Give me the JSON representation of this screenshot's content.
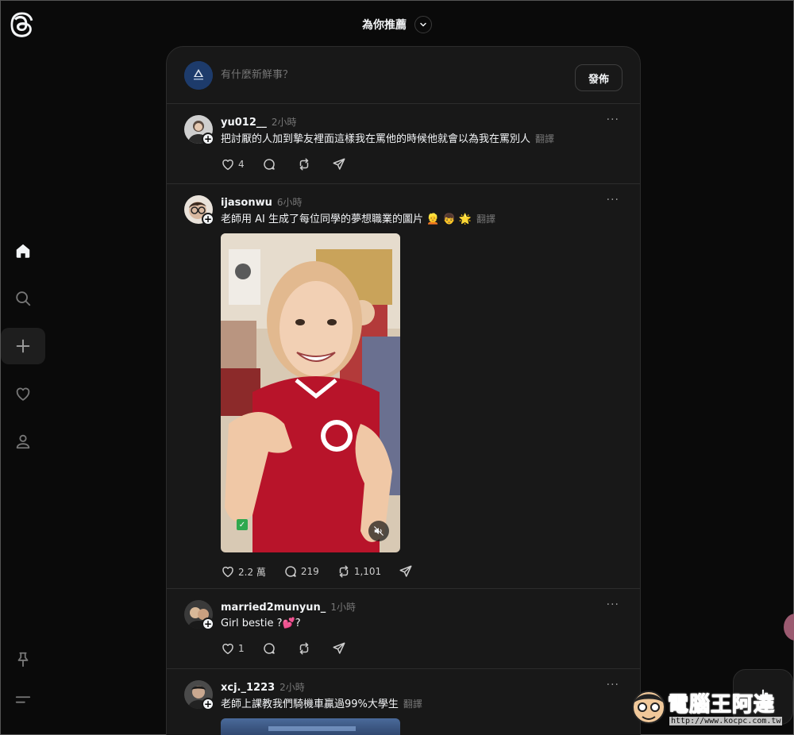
{
  "header": {
    "feed_title": "為你推薦"
  },
  "composer": {
    "placeholder": "有什麼新鮮事？",
    "post_label": "發佈"
  },
  "posts": [
    {
      "username": "yu012__",
      "time": "2小時",
      "text": "把討厭的人加到摯友裡面這樣我在罵他的時候他就會以為我在罵別人",
      "translate": "翻譯",
      "likes": "4",
      "replies": "",
      "reposts": ""
    },
    {
      "username": "ijasonwu",
      "time": "6小時",
      "text": "老師用 AI 生成了每位同學的夢想職業的圖片 👱 👦 🌟",
      "translate": "翻譯",
      "likes": "2.2 萬",
      "replies": "219",
      "reposts": "1,101"
    },
    {
      "username": "married2munyun_",
      "time": "1小時",
      "text": "Girl bestie ?💕?",
      "translate": "",
      "likes": "1",
      "replies": "",
      "reposts": ""
    },
    {
      "username": "xcj._1223",
      "time": "2小時",
      "text": "老師上課教我們騎機車贏過99%大學生",
      "translate": "翻譯",
      "likes": "",
      "replies": "",
      "reposts": ""
    }
  ],
  "more_label": "···",
  "icons": {
    "logo": "threads-logo-icon",
    "home": "home-icon",
    "search": "search-icon",
    "create": "plus-icon",
    "activity": "heart-icon",
    "profile": "profile-icon",
    "pin": "pin-icon",
    "menu": "menu-icon"
  },
  "watermark": {
    "name": "電腦王阿達",
    "url": "http://www.kocpc.com.tw"
  },
  "colors": {
    "background": "#0a0a0a",
    "card": "#181818",
    "border": "#2c2c2c",
    "text": "#f3f5f7",
    "muted": "#777777"
  }
}
